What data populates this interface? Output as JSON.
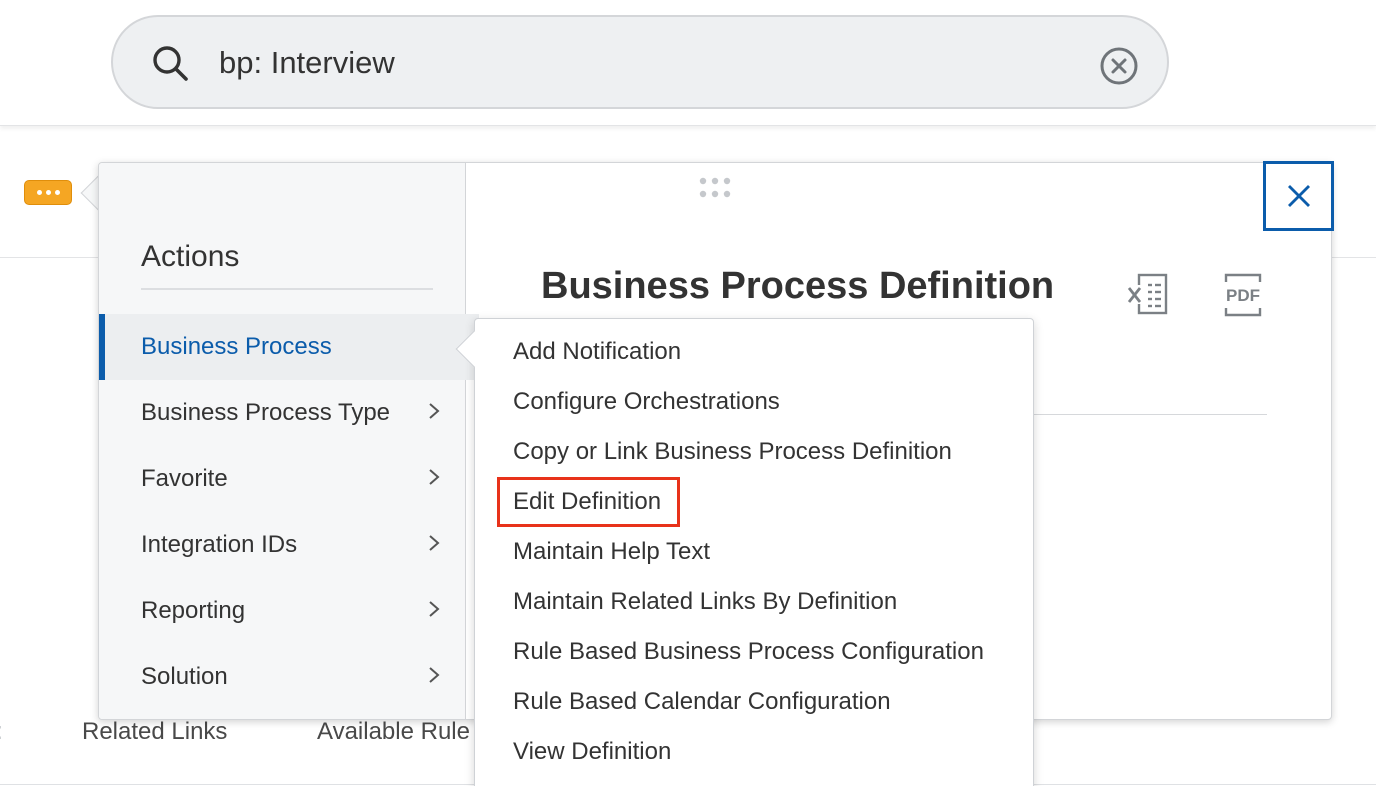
{
  "search": {
    "value": "bp: Interview"
  },
  "page_tabs": {
    "related_links": "Related Links",
    "available_rules": "Available Rule"
  },
  "actions_panel": {
    "heading": "Actions",
    "items": [
      {
        "label": "Business Process",
        "active": true
      },
      {
        "label": "Business Process Type"
      },
      {
        "label": "Favorite"
      },
      {
        "label": "Integration IDs"
      },
      {
        "label": "Reporting"
      },
      {
        "label": "Solution"
      }
    ]
  },
  "popup": {
    "title": "Business Process Definition",
    "excel_icon": "excel-export-icon",
    "pdf_icon": "pdf-export-icon"
  },
  "submenu": {
    "items": [
      "Add Notification",
      "Configure Orchestrations",
      "Copy or Link Business Process Definition",
      "Edit Definition",
      "Maintain Help Text",
      "Maintain Related Links By Definition",
      "Rule Based Business Process Configuration",
      "Rule Based Calendar Configuration",
      "View Definition"
    ],
    "highlighted": "Edit Definition"
  },
  "colors": {
    "accent": "#0b5cab",
    "highlight": "#e8321a",
    "related_actions": "#f5a623"
  }
}
